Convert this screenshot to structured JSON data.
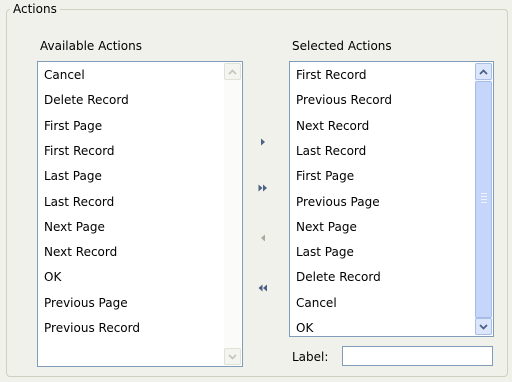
{
  "group": {
    "title": "Actions"
  },
  "available": {
    "heading": "Available Actions",
    "items": [
      "Cancel",
      "Delete Record",
      "First Page",
      "First Record",
      "Last Page",
      "Last Record",
      "Next Page",
      "Next Record",
      "OK",
      "Previous Page",
      "Previous Record"
    ]
  },
  "selected": {
    "heading": "Selected Actions",
    "items": [
      "First Record",
      "Previous Record",
      "Next Record",
      "Last Record",
      "First Page",
      "Previous Page",
      "Next Page",
      "Last Page",
      "Delete Record",
      "Cancel",
      "OK"
    ]
  },
  "move_buttons": {
    "add_icon": "arrow-right-icon",
    "add_all_icon": "double-arrow-right-icon",
    "remove_icon": "arrow-left-icon",
    "remove_all_icon": "double-arrow-left-icon"
  },
  "label_field": {
    "label": "Label:",
    "value": ""
  },
  "colors": {
    "background": "#f1f1ec",
    "list_border": "#7f9db9",
    "scroll_thumb": "#c6d6fb",
    "arrow_enabled": "#4d6185",
    "arrow_disabled": "#a9a99c"
  }
}
